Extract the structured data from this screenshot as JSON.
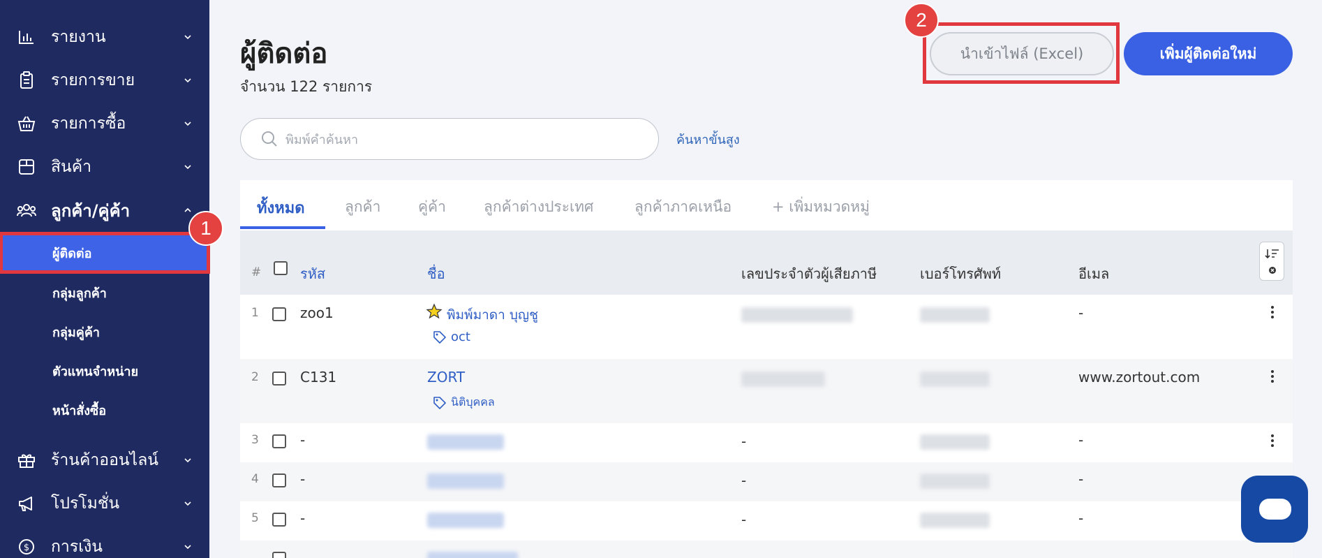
{
  "sidebar": {
    "items": [
      {
        "label": "รายงาน",
        "icon": "bar-chart-icon"
      },
      {
        "label": "รายการขาย",
        "icon": "clipboard-icon"
      },
      {
        "label": "รายการซื้อ",
        "icon": "basket-icon"
      },
      {
        "label": "สินค้า",
        "icon": "box-icon"
      },
      {
        "label": "ลูกค้า/คู่ค้า",
        "icon": "users-icon"
      },
      {
        "label": "ร้านค้าออนไลน์",
        "icon": "gift-icon"
      },
      {
        "label": "โปรโมชั่น",
        "icon": "megaphone-icon"
      },
      {
        "label": "การเงิน",
        "icon": "dollar-icon"
      }
    ],
    "sub_items": [
      {
        "label": "ผู้ติดต่อ"
      },
      {
        "label": "กลุ่มลูกค้า"
      },
      {
        "label": "กลุ่มคู่ค้า"
      },
      {
        "label": "ตัวแทนจำหน่าย"
      },
      {
        "label": "หน้าสั่งซื้อ"
      }
    ]
  },
  "annotations": {
    "badge1": "1",
    "badge2": "2"
  },
  "header": {
    "title": "ผู้ติดต่อ",
    "count": "จำนวน 122 รายการ",
    "import_label": "นำเข้าไฟล์ (Excel)",
    "add_label": "เพิ่มผู้ติดต่อใหม่"
  },
  "search": {
    "placeholder": "พิมพ์คำค้นหา",
    "advanced": "ค้นหาขั้นสูง"
  },
  "tabs": [
    {
      "label": "ทั้งหมด"
    },
    {
      "label": "ลูกค้า"
    },
    {
      "label": "คู่ค้า"
    },
    {
      "label": "ลูกค้าต่างประเทศ"
    },
    {
      "label": "ลูกค้าภาคเหนือ"
    },
    {
      "label": "+ เพิ่มหมวดหมู่"
    }
  ],
  "table": {
    "columns": {
      "hash": "#",
      "code": "รหัส",
      "name": "ชื่อ",
      "taxid": "เลขประจำตัวผู้เสียภาษี",
      "phone": "เบอร์โทรศัพท์",
      "email": "อีเมล"
    },
    "rows": [
      {
        "num": "1",
        "code": "zoo1",
        "name": "พิมพ์มาดา บุญชู",
        "tag": "oct",
        "taxid": "",
        "email": "-"
      },
      {
        "num": "2",
        "code": "C131",
        "name": "ZORT",
        "tag": "นิติบุคคล",
        "taxid": "",
        "email": "www.zortout.com"
      },
      {
        "num": "3",
        "code": "-",
        "name": "",
        "taxid": "-",
        "email": "-"
      },
      {
        "num": "4",
        "code": "-",
        "name": "",
        "taxid": "-",
        "email": "-"
      },
      {
        "num": "5",
        "code": "-",
        "name": "",
        "taxid": "-",
        "email": "-"
      }
    ]
  },
  "colors": {
    "sidebar": "#1f2a60",
    "accent": "#3a61e3",
    "highlight": "#e0383e"
  }
}
